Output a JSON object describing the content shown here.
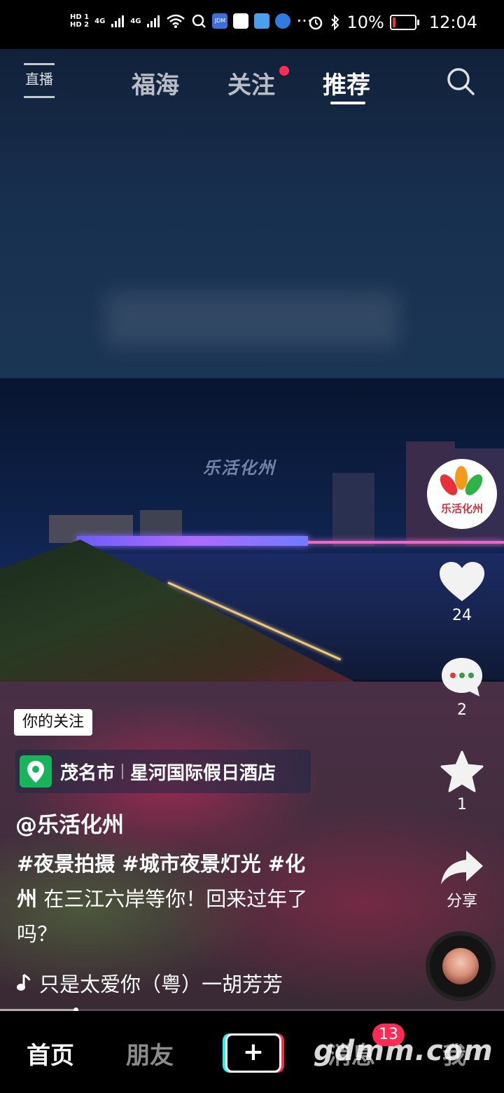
{
  "status_bar": {
    "hd1": "HD 1",
    "hd2": "HD 2",
    "net1": "4G",
    "net2": "4G",
    "battery_pct": "10%",
    "time": "12:04",
    "jdm": "JDM",
    "more": "···"
  },
  "top_nav": {
    "live_label": "直播",
    "tabs": [
      {
        "label": "福海"
      },
      {
        "label": "关注"
      },
      {
        "label": "推荐"
      }
    ],
    "active_tab": "推荐"
  },
  "video": {
    "watermark": "乐活化州"
  },
  "right_rail": {
    "avatar_name": "乐活化州",
    "like_count": "24",
    "comment_count": "2",
    "favorite_count": "1",
    "share_label": "分享"
  },
  "post": {
    "follow_tag": "你的关注",
    "location_city": "茂名市",
    "location_place": "星河国际假日酒店",
    "author": "@乐活化州",
    "hashtags_line": "#夜景拍摄 #城市夜景灯光 #化",
    "desc_line2_tag": "州",
    "desc_line2_text": " 在三江六岸等你！回来过年了",
    "desc_line3": "吗？",
    "music": "只是太爱你（粤）一胡芳芳",
    "progress": 0.15
  },
  "bottom_nav": {
    "home": "首页",
    "friends": "朋友",
    "plus": "+",
    "messages": "消息",
    "me": "我",
    "messages_badge": "13"
  },
  "site_watermark": "gdmm.com",
  "colors": {
    "accent_red": "#fe2c55",
    "tiktok_cyan": "#25f4ee",
    "location_green": "#18b35a"
  }
}
